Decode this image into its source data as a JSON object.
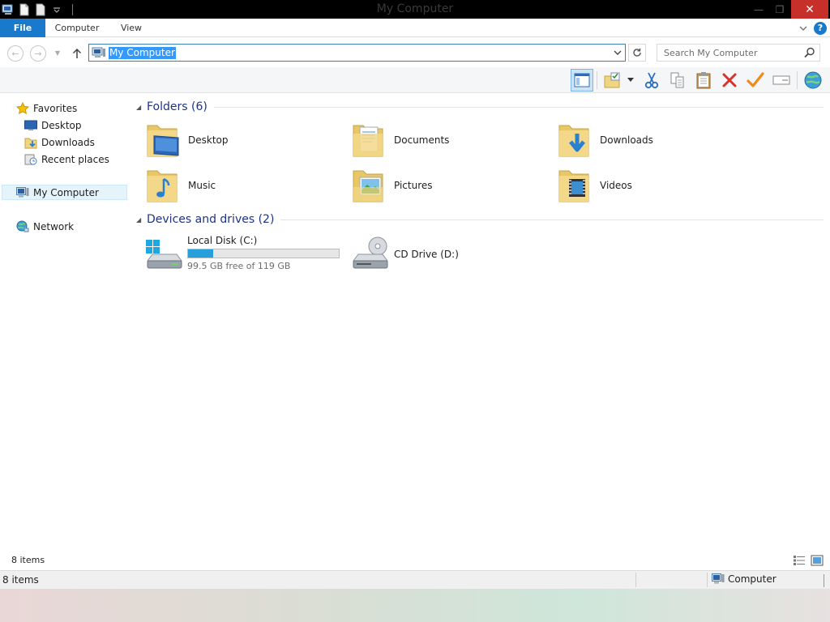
{
  "window": {
    "title": "My Computer"
  },
  "ribbon": {
    "tabs": [
      "File",
      "Computer",
      "View"
    ]
  },
  "address": {
    "path": "My Computer"
  },
  "search": {
    "placeholder": "Search My Computer"
  },
  "nav": {
    "favorites": {
      "label": "Favorites",
      "items": [
        "Desktop",
        "Downloads",
        "Recent places"
      ]
    },
    "computer": "My Computer",
    "network": "Network"
  },
  "content": {
    "folders": {
      "header": "Folders (6)",
      "items": [
        "Desktop",
        "Documents",
        "Downloads",
        "Music",
        "Pictures",
        "Videos"
      ]
    },
    "drives": {
      "header": "Devices and drives (2)",
      "local": {
        "name": "Local Disk (C:)",
        "free_text": "99.5 GB free of 119 GB",
        "used_fraction": 0.164
      },
      "cd": {
        "name": "CD Drive (D:)"
      }
    }
  },
  "status": {
    "items_top": "8 items",
    "items_bottom": "8 items",
    "zone": "Computer"
  },
  "colors": {
    "accent": "#1979ca",
    "header_text": "#1e3287",
    "close": "#c7302a",
    "drive_fill": "#26a0da"
  }
}
